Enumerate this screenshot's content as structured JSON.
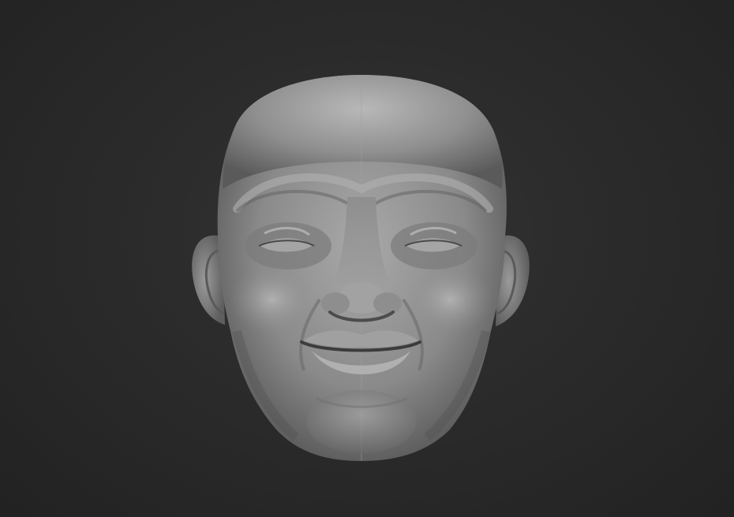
{
  "scene": {
    "subject": "sculpted-head-model",
    "colors": {
      "background": "#2a2a2a",
      "clay_base": "#8e8e8e",
      "clay_highlight": "#bdbdbd",
      "clay_shadow": "#4a4a4a"
    }
  }
}
